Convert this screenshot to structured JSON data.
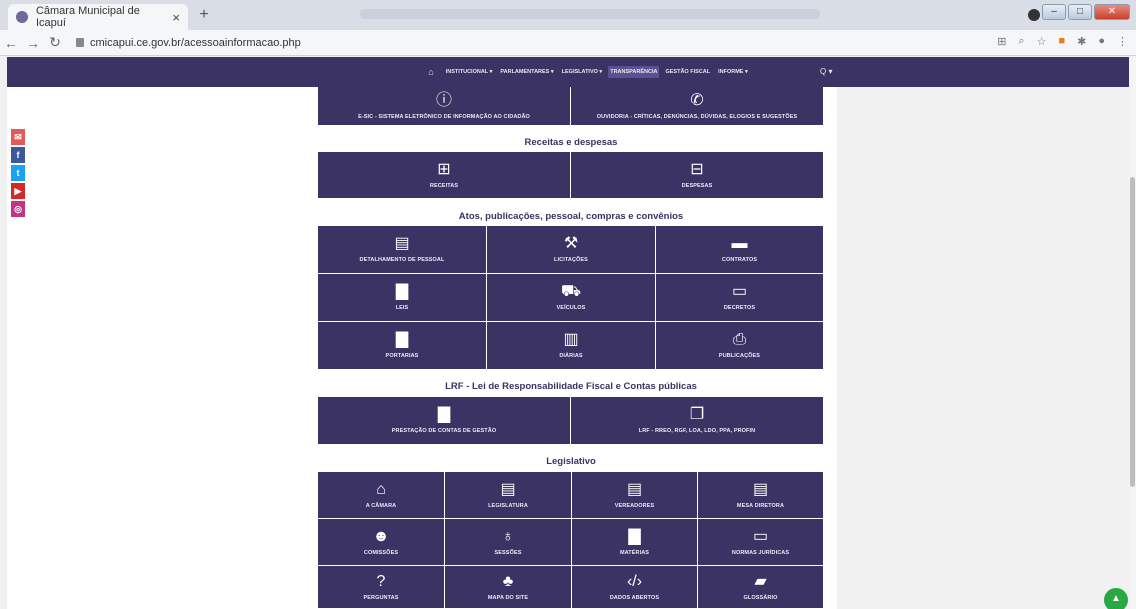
{
  "browser": {
    "tab_title": "Câmara Municipal de Icapuí",
    "tab_close": "×",
    "new_tab": "+",
    "url": "cmicapui.ce.gov.br/acessoainformacao.php"
  },
  "nav": {
    "items": [
      "INSTITUCIONAL ▾",
      "PARLAMENTARES ▾",
      "LEGISLATIVO ▾",
      "TRANSPARÊNCIA",
      "GESTÃO FISCAL",
      "INFORME ▾"
    ],
    "search": "Q ▾"
  },
  "top_tiles": [
    {
      "label": "E-SIC - SISTEMA ELETRÔNICO DE INFORMAÇÃO AO CIDADÃO",
      "icon": "info-icon"
    },
    {
      "label": "OUVIDORIA - CRÍTICAS, DENÚNCIAS, DÚVIDAS, ELOGIOS E SUGESTÕES",
      "icon": "phone-icon"
    }
  ],
  "sections": {
    "receitas_title": "Receitas e despesas",
    "atos_title": "Atos, publicações, pessoal, compras e convênios",
    "lrf_title": "LRF - Lei de Responsabilidade Fiscal e Contas públicas",
    "legislativo_title": "Legislativo"
  },
  "receitas": [
    {
      "label": "RECEITAS",
      "icon": "plus-square-icon"
    },
    {
      "label": "DESPESAS",
      "icon": "minus-square-icon"
    }
  ],
  "atos": [
    {
      "label": "DETALHAMENTO DE PESSOAL",
      "icon": "id-card-icon"
    },
    {
      "label": "LICITAÇÕES",
      "icon": "gavel-icon"
    },
    {
      "label": "CONTRATOS",
      "icon": "briefcase-icon"
    },
    {
      "label": "LEIS",
      "icon": "file-icon"
    },
    {
      "label": "VEÍCULOS",
      "icon": "bus-icon"
    },
    {
      "label": "DECRETOS",
      "icon": "file-outline-icon"
    },
    {
      "label": "PORTARIAS",
      "icon": "file-icon"
    },
    {
      "label": "DIÁRIAS",
      "icon": "suitcase-icon"
    },
    {
      "label": "PUBLICAÇÕES",
      "icon": "pdf-icon"
    }
  ],
  "lrf": [
    {
      "label": "PRESTAÇÃO DE CONTAS DE GESTÃO",
      "icon": "file-icon"
    },
    {
      "label": "LRF - RREO, RGF, LOA, LDO, PPA, PROFIN",
      "icon": "copy-icon"
    }
  ],
  "legislativo": [
    {
      "label": "A CÂMARA",
      "icon": "institution-icon"
    },
    {
      "label": "LEGISLATURA",
      "icon": "id-card-icon"
    },
    {
      "label": "VEREADORES",
      "icon": "id-card-icon"
    },
    {
      "label": "MESA DIRETORA",
      "icon": "id-card-icon"
    },
    {
      "label": "COMISSÕES",
      "icon": "users-icon"
    },
    {
      "label": "SESSÕES",
      "icon": "microphone-icon"
    },
    {
      "label": "MATÉRIAS",
      "icon": "file-icon"
    },
    {
      "label": "NORMAS JURÍDICAS",
      "icon": "file-outline-icon"
    },
    {
      "label": "PERGUNTAS",
      "icon": "question-icon"
    },
    {
      "label": "MAPA DO SITE",
      "icon": "sitemap-icon"
    },
    {
      "label": "DADOS ABERTOS",
      "icon": "code-icon"
    },
    {
      "label": "GLOSSÁRIO",
      "icon": "book-icon"
    }
  ],
  "colors": {
    "tile": "#3a3363",
    "nav": "#3a3363",
    "fab": "#29a745"
  }
}
